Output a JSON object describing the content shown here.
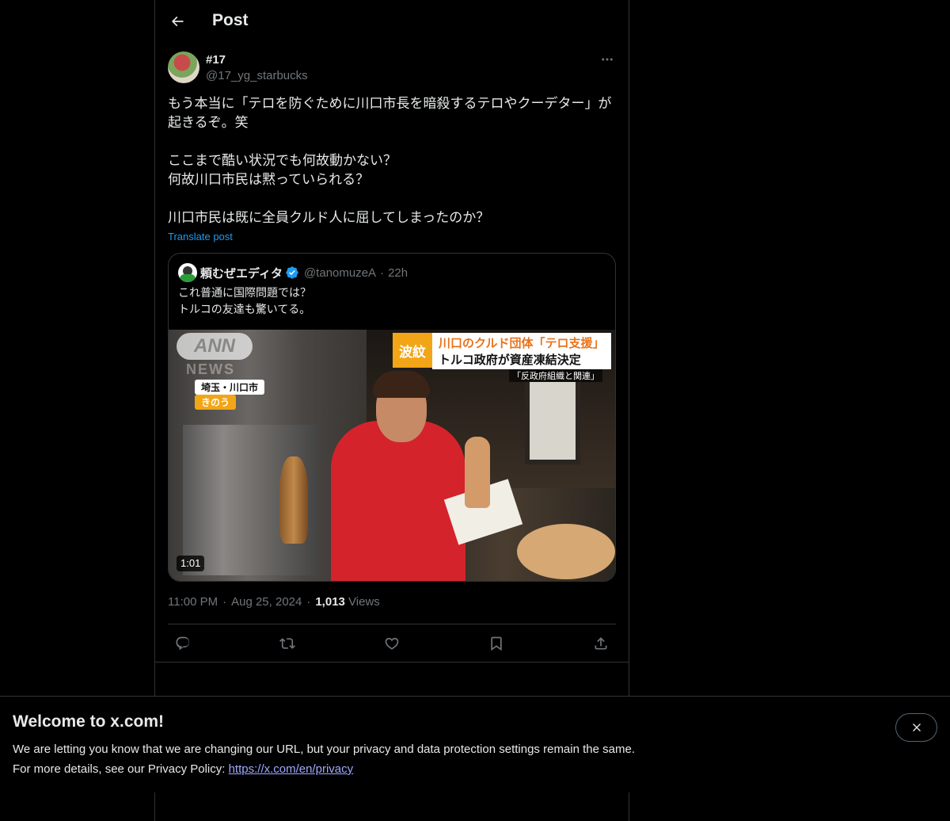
{
  "header": {
    "title": "Post",
    "back_icon": "arrow-left-icon"
  },
  "author": {
    "name": "#17",
    "handle": "@17_yg_starbucks",
    "more_icon": "more-horizontal-icon"
  },
  "post": {
    "paragraphs": [
      "もう本当に「テロを防ぐために川口市長を暗殺するテロやクーデター」が起きるぞ。笑",
      "ここまで酷い状況でも何故動かない？\n何故川口市民は黙っていられる？",
      "川口市民は既に全員クルド人に屈してしまったのか？"
    ],
    "translate_label": "Translate post"
  },
  "quote": {
    "name": "頼むぜエディタ",
    "verified": true,
    "handle": "@tanomuzeA",
    "time": "22h",
    "lines": [
      "これ普通に国際問題では？",
      "トルコの友達も驚いてる。"
    ],
    "video": {
      "duration": "1:01",
      "logo": "ANN",
      "logo_sub": "NEWS",
      "location": "埼玉・川口市",
      "when": "きのう",
      "tag": "波紋",
      "headline_1": "川口のクルド団体「テロ支援」",
      "headline_2": "トルコ政府が資産凍結決定",
      "caption": "「反政府組織と関連」"
    }
  },
  "meta": {
    "time": "11:00 PM",
    "date": "Aug 25, 2024",
    "views_count": "1,013",
    "views_label": "Views"
  },
  "actions": [
    "reply-icon",
    "repost-icon",
    "like-icon",
    "bookmark-icon",
    "share-icon"
  ],
  "banner": {
    "title": "Welcome to x.com!",
    "line1": "We are letting you know that we are changing our URL, but your privacy and data protection settings remain the same.",
    "line2_prefix": "For more details, see our Privacy Policy: ",
    "link": "https://x.com/en/privacy",
    "close_icon": "close-icon"
  },
  "colors": {
    "background": "#000000",
    "text": "#e7e9ea",
    "muted": "#71767b",
    "accent": "#1d9bf0",
    "border": "#2f3336"
  }
}
